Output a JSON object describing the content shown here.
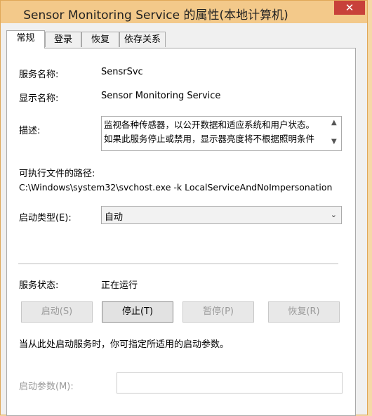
{
  "window": {
    "title": "Sensor Monitoring Service 的属性(本地计算机)",
    "close_glyph": "✕"
  },
  "tabs": [
    {
      "label": "常规",
      "active": true
    },
    {
      "label": "登录",
      "active": false
    },
    {
      "label": "恢复",
      "active": false
    },
    {
      "label": "依存关系",
      "active": false
    }
  ],
  "general": {
    "service_name_label": "服务名称:",
    "service_name_value": "SensrSvc",
    "display_name_label": "显示名称:",
    "display_name_value": "Sensor Monitoring Service",
    "description_label": "描述:",
    "description_lines": [
      "监视各种传感器，以公开数据和适应系统和用户状态。",
      "如果此服务停止或禁用，显示器亮度将不根据照明条件"
    ],
    "path_label": "可执行文件的路径:",
    "path_value": "C:\\Windows\\system32\\svchost.exe -k LocalServiceAndNoImpersonation",
    "startup_type_label": "启动类型(E):",
    "startup_type_value": "自动",
    "status_label": "服务状态:",
    "status_value": "正在运行",
    "buttons": {
      "start": "启动(S)",
      "stop": "停止(T)",
      "pause": "暂停(P)",
      "resume": "恢复(R)"
    },
    "hint": "当从此处启动服务时，你可指定所适用的启动参数。",
    "params_label": "启动参数(M):",
    "params_value": ""
  },
  "icons": {
    "scroll_up": "▲",
    "scroll_down": "▼",
    "dropdown": "⌄"
  }
}
